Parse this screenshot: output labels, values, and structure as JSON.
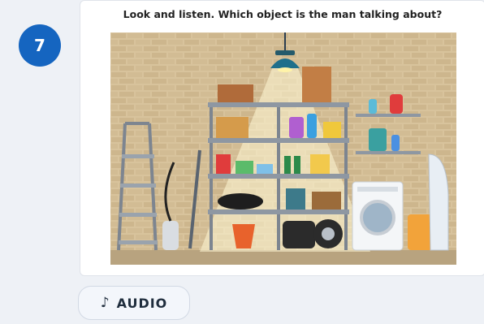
{
  "question": {
    "number": "7",
    "prompt": "Look and listen. Which object is the man talking about?"
  },
  "illustration": {
    "subject": "garage storage room"
  },
  "audio_button": {
    "icon": "music-note-icon",
    "glyph": "♪",
    "label": "AUDIO"
  },
  "colors": {
    "accent": "#1565c0",
    "card": "#ffffff",
    "background": "#eef1f6"
  }
}
